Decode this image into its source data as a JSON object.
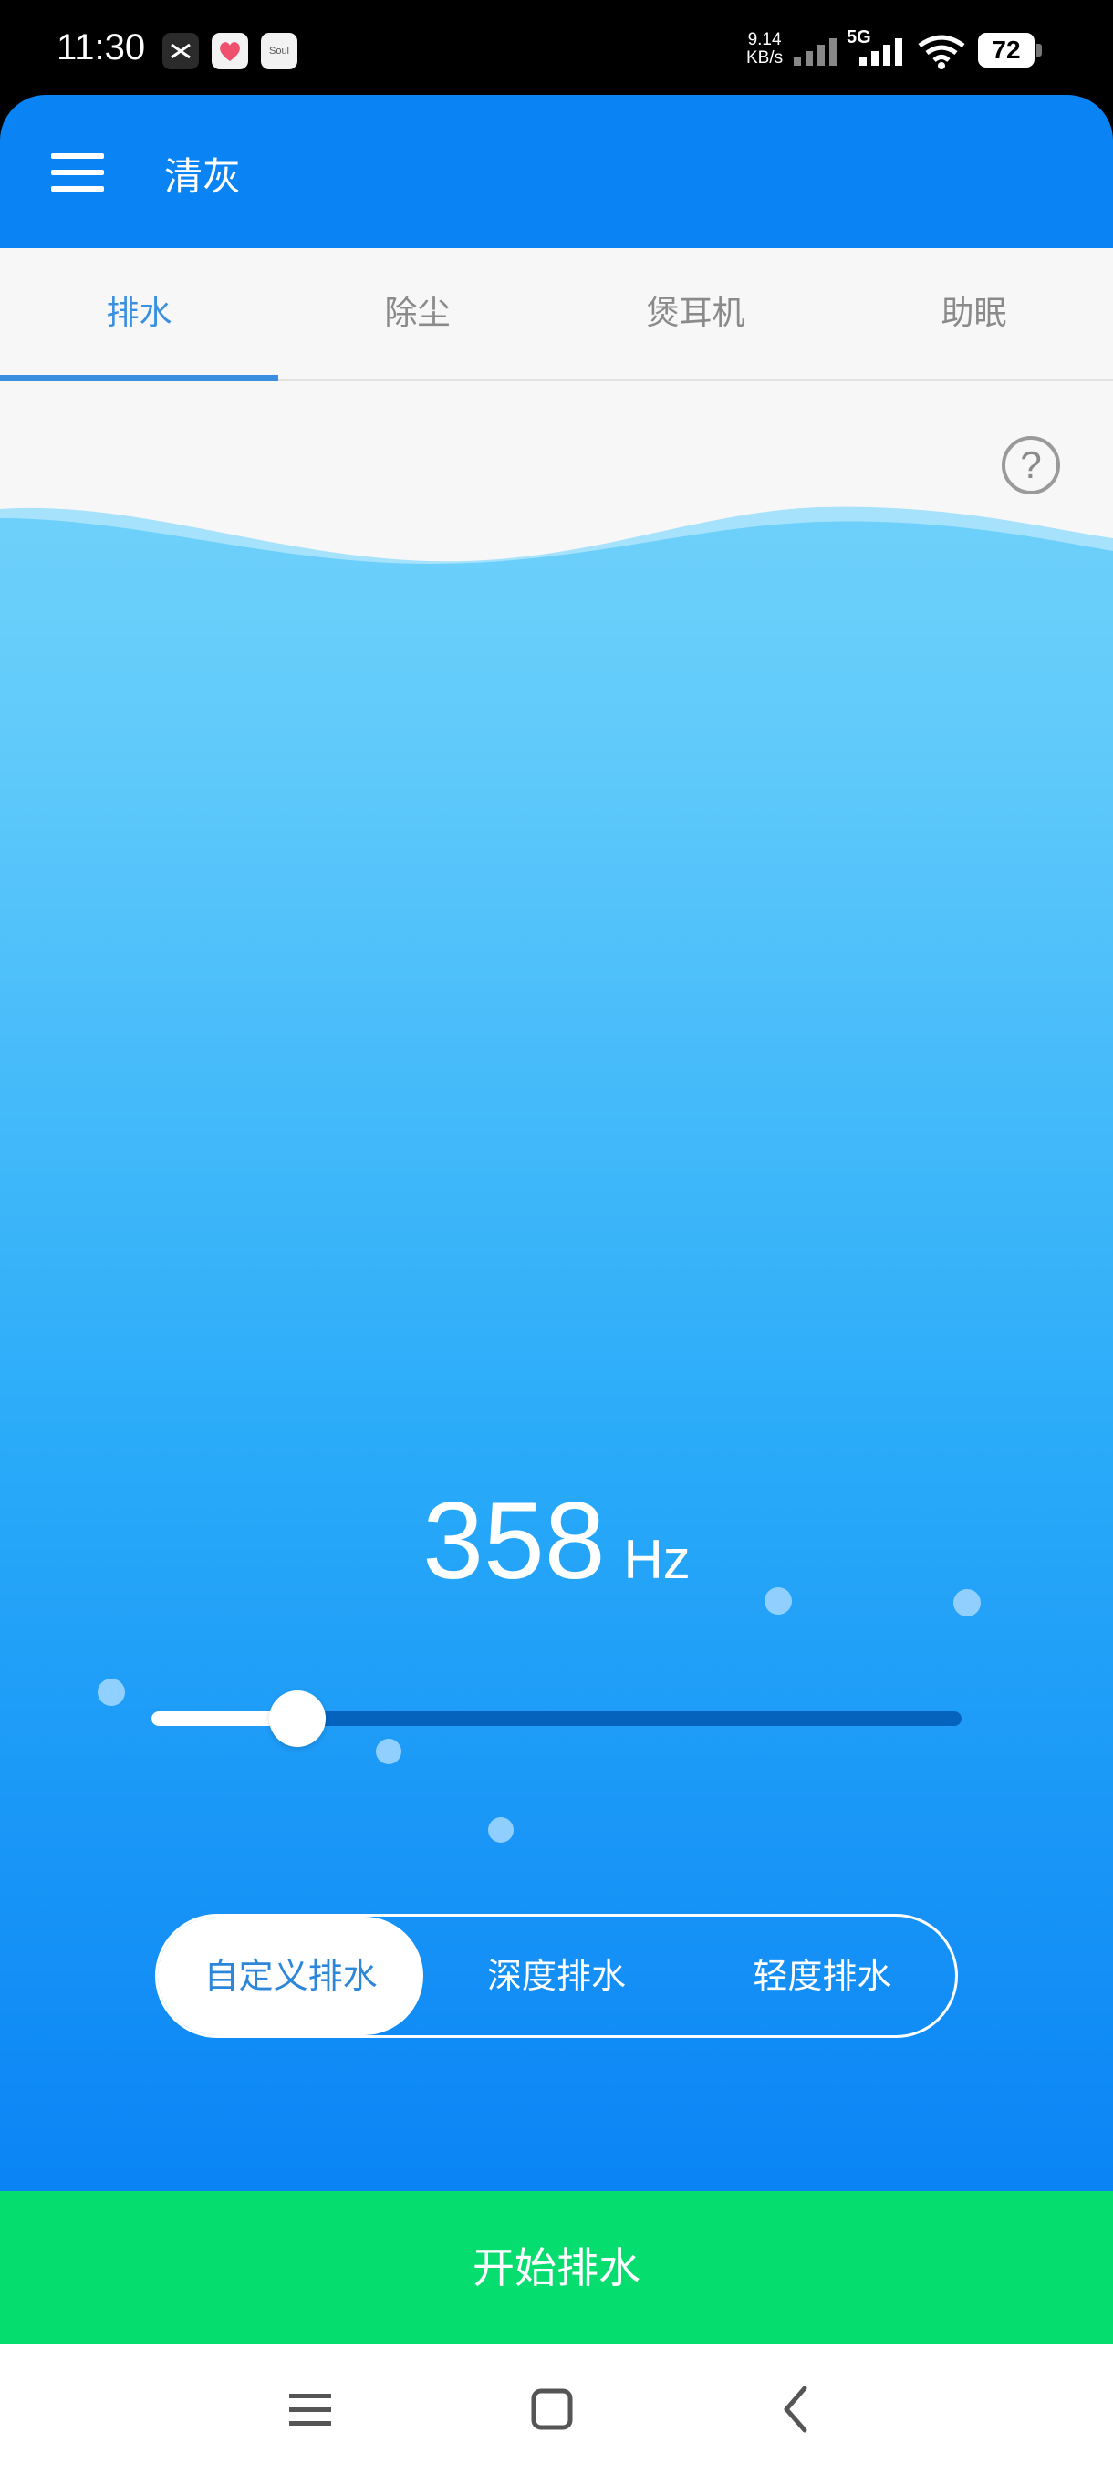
{
  "status_bar": {
    "time": "11:30",
    "net_speed_value": "9.14",
    "net_speed_unit": "KB/s",
    "network_type": "5G",
    "battery": "72",
    "notification_icons": [
      "capcut-icon",
      "heart-app-icon",
      "soul-app-icon"
    ],
    "soul_label": "Soul"
  },
  "header": {
    "title": "清灰"
  },
  "tabs": [
    {
      "label": "排水",
      "active": true
    },
    {
      "label": "除尘",
      "active": false
    },
    {
      "label": "煲耳机",
      "active": false
    },
    {
      "label": "助眠",
      "active": false
    }
  ],
  "frequency": {
    "value": "358",
    "unit": "Hz",
    "slider_fraction": 0.18
  },
  "modes": [
    {
      "label": "自定义排水",
      "active": true
    },
    {
      "label": "深度排水",
      "active": false
    },
    {
      "label": "轻度排水",
      "active": false
    }
  ],
  "start_button": {
    "label": "开始排水"
  },
  "colors": {
    "header": "#0a84f5",
    "water_top": "#6dd0fa",
    "water_bottom": "#0a84f5",
    "start_button": "#05dd6e",
    "tab_active": "#3a8fe0"
  }
}
